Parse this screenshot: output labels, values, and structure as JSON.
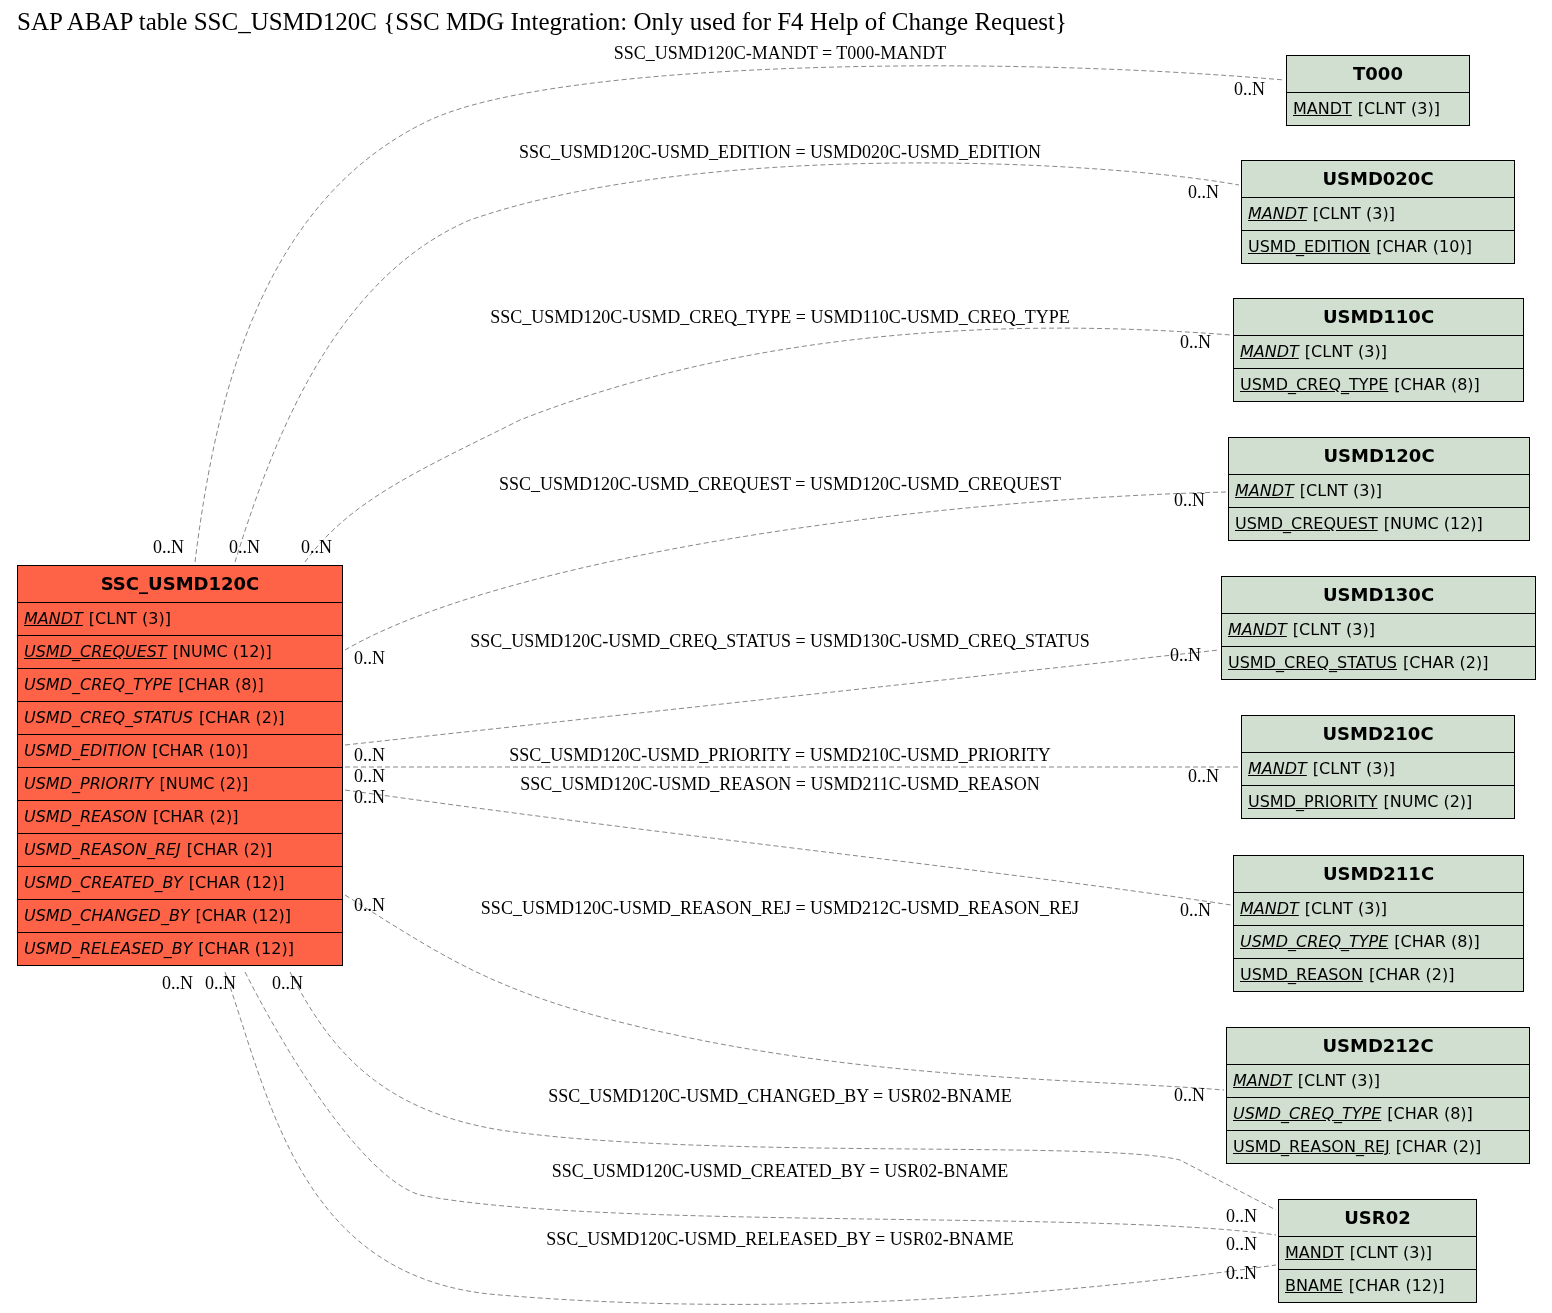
{
  "title": "SAP ABAP table SSC_USMD120C {SSC MDG Integration: Only used for F4 Help of Change Request}",
  "main_table": {
    "name": "SSC_USMD120C",
    "fields": [
      {
        "name": "MANDT",
        "type": "[CLNT (3)]",
        "key": true,
        "foreign": true
      },
      {
        "name": "USMD_CREQUEST",
        "type": "[NUMC (12)]",
        "key": true,
        "foreign": true
      },
      {
        "name": "USMD_CREQ_TYPE",
        "type": "[CHAR (8)]",
        "key": false,
        "foreign": true
      },
      {
        "name": "USMD_CREQ_STATUS",
        "type": "[CHAR (2)]",
        "key": false,
        "foreign": true
      },
      {
        "name": "USMD_EDITION",
        "type": "[CHAR (10)]",
        "key": false,
        "foreign": true
      },
      {
        "name": "USMD_PRIORITY",
        "type": "[NUMC (2)]",
        "key": false,
        "foreign": true
      },
      {
        "name": "USMD_REASON",
        "type": "[CHAR (2)]",
        "key": false,
        "foreign": true
      },
      {
        "name": "USMD_REASON_REJ",
        "type": "[CHAR (2)]",
        "key": false,
        "foreign": true
      },
      {
        "name": "USMD_CREATED_BY",
        "type": "[CHAR (12)]",
        "key": false,
        "foreign": true
      },
      {
        "name": "USMD_CHANGED_BY",
        "type": "[CHAR (12)]",
        "key": false,
        "foreign": true
      },
      {
        "name": "USMD_RELEASED_BY",
        "type": "[CHAR (12)]",
        "key": false,
        "foreign": true
      }
    ]
  },
  "tables": [
    {
      "name": "T000",
      "fields": [
        {
          "name": "MANDT",
          "type": "[CLNT (3)]",
          "key": true,
          "foreign": false
        }
      ]
    },
    {
      "name": "USMD020C",
      "fields": [
        {
          "name": "MANDT",
          "type": "[CLNT (3)]",
          "key": true,
          "foreign": true
        },
        {
          "name": "USMD_EDITION",
          "type": "[CHAR (10)]",
          "key": true,
          "foreign": false
        }
      ]
    },
    {
      "name": "USMD110C",
      "fields": [
        {
          "name": "MANDT",
          "type": "[CLNT (3)]",
          "key": true,
          "foreign": true
        },
        {
          "name": "USMD_CREQ_TYPE",
          "type": "[CHAR (8)]",
          "key": true,
          "foreign": false
        }
      ]
    },
    {
      "name": "USMD120C",
      "fields": [
        {
          "name": "MANDT",
          "type": "[CLNT (3)]",
          "key": true,
          "foreign": true
        },
        {
          "name": "USMD_CREQUEST",
          "type": "[NUMC (12)]",
          "key": true,
          "foreign": false
        }
      ]
    },
    {
      "name": "USMD130C",
      "fields": [
        {
          "name": "MANDT",
          "type": "[CLNT (3)]",
          "key": true,
          "foreign": true
        },
        {
          "name": "USMD_CREQ_STATUS",
          "type": "[CHAR (2)]",
          "key": true,
          "foreign": false
        }
      ]
    },
    {
      "name": "USMD210C",
      "fields": [
        {
          "name": "MANDT",
          "type": "[CLNT (3)]",
          "key": true,
          "foreign": true
        },
        {
          "name": "USMD_PRIORITY",
          "type": "[NUMC (2)]",
          "key": true,
          "foreign": false
        }
      ]
    },
    {
      "name": "USMD211C",
      "fields": [
        {
          "name": "MANDT",
          "type": "[CLNT (3)]",
          "key": true,
          "foreign": true
        },
        {
          "name": "USMD_CREQ_TYPE",
          "type": "[CHAR (8)]",
          "key": true,
          "foreign": true
        },
        {
          "name": "USMD_REASON",
          "type": "[CHAR (2)]",
          "key": true,
          "foreign": false
        }
      ]
    },
    {
      "name": "USMD212C",
      "fields": [
        {
          "name": "MANDT",
          "type": "[CLNT (3)]",
          "key": true,
          "foreign": true
        },
        {
          "name": "USMD_CREQ_TYPE",
          "type": "[CHAR (8)]",
          "key": true,
          "foreign": true
        },
        {
          "name": "USMD_REASON_REJ",
          "type": "[CHAR (2)]",
          "key": true,
          "foreign": false
        }
      ]
    },
    {
      "name": "USR02",
      "fields": [
        {
          "name": "MANDT",
          "type": "[CLNT (3)]",
          "key": true,
          "foreign": false
        },
        {
          "name": "BNAME",
          "type": "[CHAR (12)]",
          "key": true,
          "foreign": false
        }
      ]
    }
  ],
  "relations": [
    {
      "label": "SSC_USMD120C-MANDT = T000-MANDT",
      "from_card": "0..N",
      "to_card": "0..N"
    },
    {
      "label": "SSC_USMD120C-USMD_EDITION = USMD020C-USMD_EDITION",
      "from_card": "0..N",
      "to_card": "0..N"
    },
    {
      "label": "SSC_USMD120C-USMD_CREQ_TYPE = USMD110C-USMD_CREQ_TYPE",
      "from_card": "0..N",
      "to_card": "0..N"
    },
    {
      "label": "SSC_USMD120C-USMD_CREQUEST = USMD120C-USMD_CREQUEST",
      "from_card": "0..N",
      "to_card": "0..N"
    },
    {
      "label": "SSC_USMD120C-USMD_CREQ_STATUS = USMD130C-USMD_CREQ_STATUS",
      "from_card": "0..N",
      "to_card": "0..N"
    },
    {
      "label": "SSC_USMD120C-USMD_PRIORITY = USMD210C-USMD_PRIORITY",
      "from_card": "0..N",
      "to_card": "0..N"
    },
    {
      "label": "SSC_USMD120C-USMD_REASON = USMD211C-USMD_REASON",
      "from_card": "0..N",
      "to_card": "0..N"
    },
    {
      "label": "SSC_USMD120C-USMD_REASON_REJ = USMD212C-USMD_REASON_REJ",
      "from_card": "0..N",
      "to_card": "0..N"
    },
    {
      "label": "SSC_USMD120C-USMD_CHANGED_BY = USR02-BNAME",
      "from_card": "0..N",
      "to_card": "0..N"
    },
    {
      "label": "SSC_USMD120C-USMD_CREATED_BY = USR02-BNAME",
      "from_card": "0..N",
      "to_card": "0..N"
    },
    {
      "label": "SSC_USMD120C-USMD_RELEASED_BY = USR02-BNAME",
      "from_card": "0..N",
      "to_card": "0..N"
    }
  ]
}
